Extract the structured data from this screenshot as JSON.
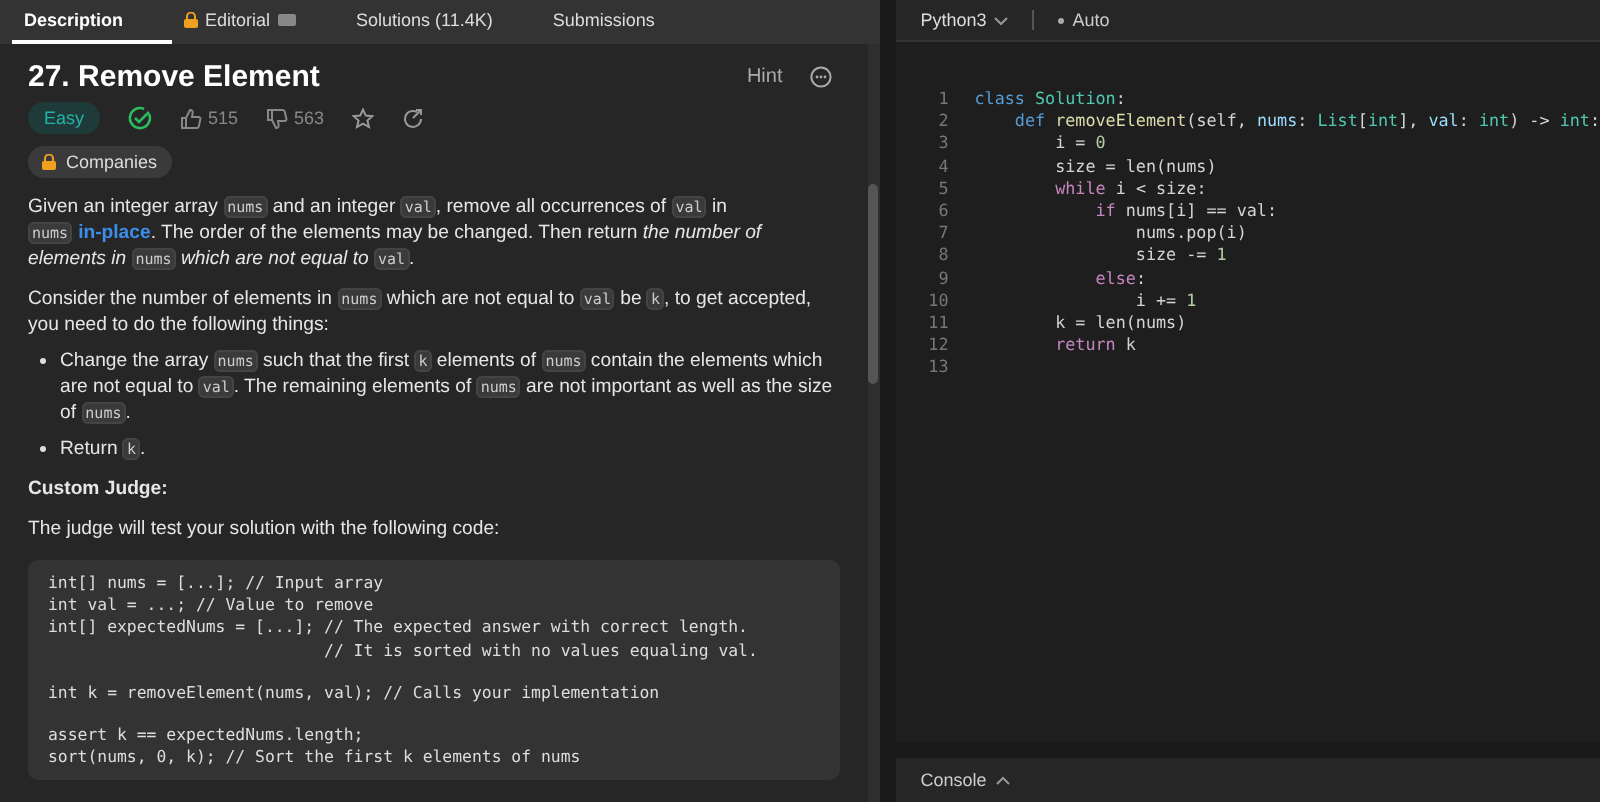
{
  "tabs": [
    {
      "label": "Description",
      "selected": true,
      "locked": false,
      "video": false
    },
    {
      "label": "Editorial",
      "selected": false,
      "locked": true,
      "video": true
    },
    {
      "label": "Solutions (11.4K)",
      "selected": false,
      "locked": false,
      "video": false
    },
    {
      "label": "Submissions",
      "selected": false,
      "locked": false,
      "video": false
    }
  ],
  "problem": {
    "title": "27. Remove Element",
    "hint": "Hint",
    "difficulty": "Easy",
    "solved": true,
    "likes": "515",
    "dislikes": "563",
    "companies": "Companies"
  },
  "description": [
    {
      "kind": "paragraph",
      "segments": [
        {
          "kind": "text",
          "text": "Given an integer array "
        },
        {
          "kind": "code",
          "text": "nums"
        },
        {
          "kind": "text",
          "text": " and an integer "
        },
        {
          "kind": "code",
          "text": "val"
        },
        {
          "kind": "text",
          "text": ", remove all occurrences of "
        },
        {
          "kind": "code",
          "text": "val"
        },
        {
          "kind": "text",
          "text": " in "
        },
        {
          "kind": "code",
          "text": "nums"
        },
        {
          "kind": "link",
          "text": "in-place"
        },
        {
          "kind": "text",
          "text": ". The order of the elements may be changed. Then return "
        },
        {
          "kind": "italic",
          "text": "the number of elements in "
        },
        {
          "kind": "code",
          "text": "nums"
        },
        {
          "kind": "italic",
          "text": " which are not equal to "
        },
        {
          "kind": "code",
          "text": "val"
        },
        {
          "kind": "text",
          "text": "."
        }
      ]
    },
    {
      "kind": "paragraph",
      "segments": [
        {
          "kind": "text",
          "text": "Consider the number of elements in "
        },
        {
          "kind": "code",
          "text": "nums"
        },
        {
          "kind": "text",
          "text": " which are not equal to "
        },
        {
          "kind": "code",
          "text": "val"
        },
        {
          "kind": "text",
          "text": " be "
        },
        {
          "kind": "code",
          "text": "k"
        },
        {
          "kind": "text",
          "text": ", to get accepted, you need to do the following things:"
        }
      ]
    },
    {
      "kind": "bullet",
      "segments": [
        {
          "kind": "text",
          "text": "Change the array "
        },
        {
          "kind": "code",
          "text": "nums"
        },
        {
          "kind": "text",
          "text": " such that the first "
        },
        {
          "kind": "code",
          "text": "k"
        },
        {
          "kind": "text",
          "text": " elements of "
        },
        {
          "kind": "code",
          "text": "nums"
        },
        {
          "kind": "text",
          "text": " contain the elements which are not equal to "
        },
        {
          "kind": "code",
          "text": "val"
        },
        {
          "kind": "text",
          "text": ". The remaining elements of "
        },
        {
          "kind": "code",
          "text": "nums"
        },
        {
          "kind": "text",
          "text": " are not important as well as the size of "
        },
        {
          "kind": "code",
          "text": "nums"
        },
        {
          "kind": "text",
          "text": "."
        }
      ]
    },
    {
      "kind": "bullet",
      "segments": [
        {
          "kind": "text",
          "text": "Return "
        },
        {
          "kind": "code",
          "text": "k"
        },
        {
          "kind": "text",
          "text": "."
        }
      ]
    },
    {
      "kind": "heading",
      "segments": [
        {
          "kind": "text",
          "text": "Custom Judge:"
        }
      ]
    },
    {
      "kind": "paragraph",
      "segments": [
        {
          "kind": "text",
          "text": "The judge will test your solution with the following code:"
        }
      ]
    }
  ],
  "judge_code": [
    [
      "int[] nums = [...]; // Input array",
      "int val = ...; // Value to remove",
      "int[] expectedNums = [...]; // The expected answer with correct length.",
      "                            // It is sorted with no values equaling val."
    ],
    [
      "int k = removeElement(nums, val); // Calls your implementation"
    ],
    [
      "assert k == expectedNums.length;",
      "sort(nums, 0, k); // Sort the first k elements of nums"
    ]
  ],
  "editor": {
    "language": "Python3",
    "mode": "Auto",
    "lines": [
      {
        "number": "1",
        "tokens": [
          {
            "kind": "kw",
            "text": "class "
          },
          {
            "kind": "cls",
            "text": "Solution"
          },
          {
            "kind": "plain",
            "text": ":"
          }
        ]
      },
      {
        "number": "2",
        "tokens": [
          {
            "kind": "kw",
            "text": "    def "
          },
          {
            "kind": "fn",
            "text": "removeElement"
          },
          {
            "kind": "plain",
            "text": "(self, "
          },
          {
            "kind": "var",
            "text": "nums"
          },
          {
            "kind": "plain",
            "text": ": "
          },
          {
            "kind": "cls",
            "text": "List"
          },
          {
            "kind": "plain",
            "text": "["
          },
          {
            "kind": "cls",
            "text": "int"
          },
          {
            "kind": "plain",
            "text": "], "
          },
          {
            "kind": "var",
            "text": "val"
          },
          {
            "kind": "plain",
            "text": ": "
          },
          {
            "kind": "cls",
            "text": "int"
          },
          {
            "kind": "plain",
            "text": ") -> "
          },
          {
            "kind": "cls",
            "text": "int"
          },
          {
            "kind": "plain",
            "text": ":"
          }
        ]
      },
      {
        "number": "3",
        "tokens": [
          {
            "kind": "plain",
            "text": "        i = "
          },
          {
            "kind": "num",
            "text": "0"
          }
        ]
      },
      {
        "number": "4",
        "tokens": [
          {
            "kind": "plain",
            "text": "        size = len(nums)"
          }
        ]
      },
      {
        "number": "5",
        "tokens": [
          {
            "kind": "ctl",
            "text": "        while"
          },
          {
            "kind": "plain",
            "text": " i < size:"
          }
        ]
      },
      {
        "number": "6",
        "tokens": [
          {
            "kind": "ctl",
            "text": "            if"
          },
          {
            "kind": "plain",
            "text": " nums[i] == val:"
          }
        ]
      },
      {
        "number": "7",
        "tokens": [
          {
            "kind": "plain",
            "text": "                nums.pop(i)"
          }
        ]
      },
      {
        "number": "8",
        "tokens": [
          {
            "kind": "plain",
            "text": "                size -= "
          },
          {
            "kind": "num",
            "text": "1"
          }
        ]
      },
      {
        "number": "9",
        "tokens": [
          {
            "kind": "ctl",
            "text": "            else"
          },
          {
            "kind": "plain",
            "text": ":"
          }
        ]
      },
      {
        "number": "10",
        "tokens": [
          {
            "kind": "plain",
            "text": "                i += "
          },
          {
            "kind": "num",
            "text": "1"
          }
        ]
      },
      {
        "number": "11",
        "tokens": [
          {
            "kind": "plain",
            "text": "        k = len(nums)"
          }
        ]
      },
      {
        "number": "12",
        "tokens": [
          {
            "kind": "ctl",
            "text": "        return"
          },
          {
            "kind": "plain",
            "text": " k"
          }
        ]
      },
      {
        "number": "13"
      }
    ]
  },
  "console": {
    "label": "Console"
  }
}
